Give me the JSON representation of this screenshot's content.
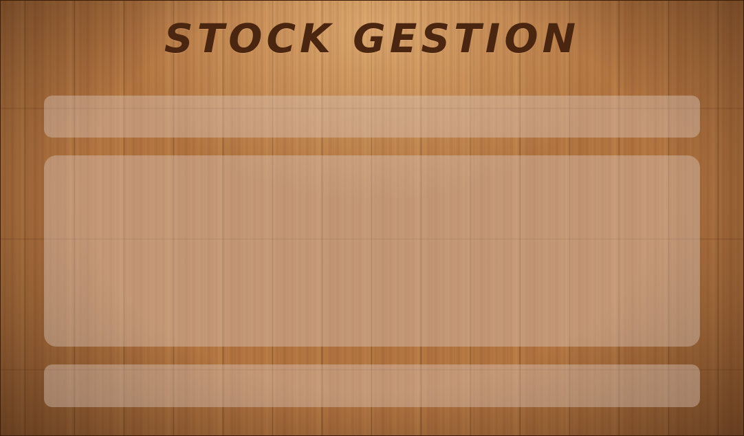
{
  "app": {
    "title": "STOCK GESTION"
  },
  "theme": {
    "background": "wood-planks",
    "title_color": "#4a2510",
    "panel_color": "rgba(220,200,190,0.42)"
  },
  "panels": {
    "top": "",
    "main": "",
    "bottom": ""
  }
}
